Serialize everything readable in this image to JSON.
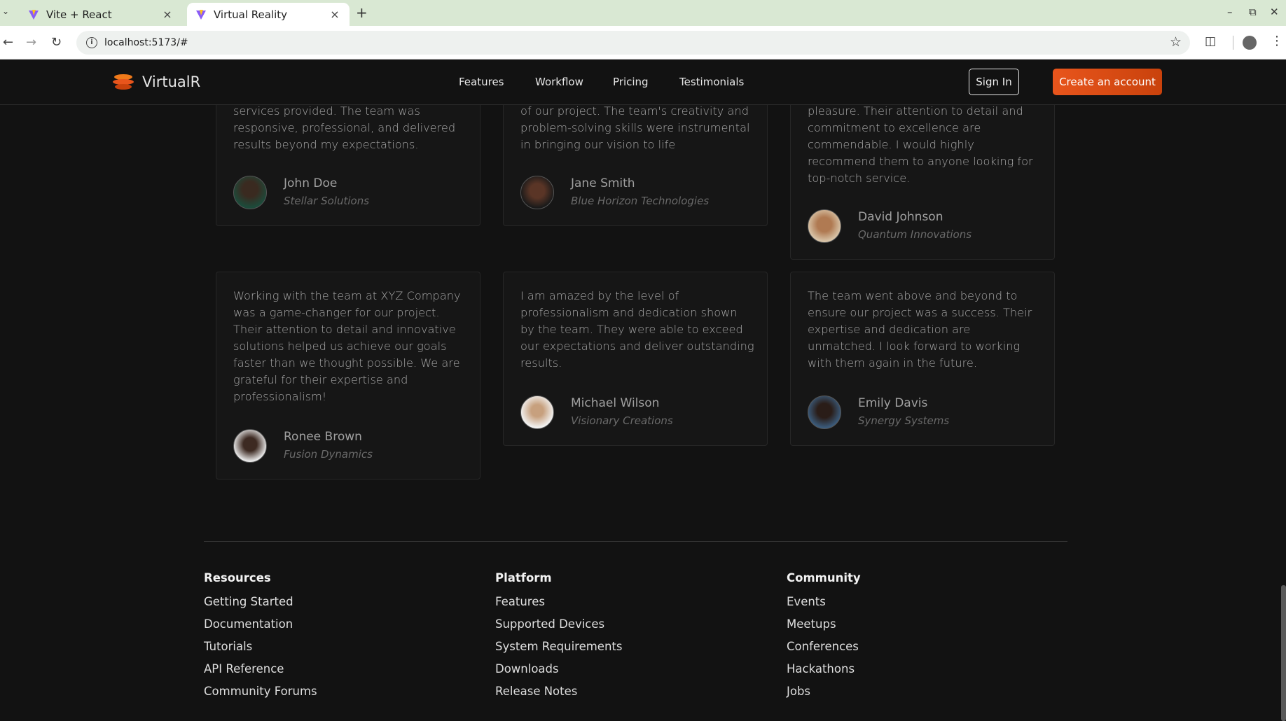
{
  "browser": {
    "tabs": [
      {
        "title": "Vite + React",
        "favicon": "vite-icon"
      },
      {
        "title": "Virtual Reality",
        "favicon": "vite-icon"
      }
    ],
    "close_glyph": "×",
    "new_tab_glyph": "+",
    "url": "localhost:5173/#"
  },
  "header": {
    "logo_text": "VirtualR",
    "nav": [
      "Features",
      "Workflow",
      "Pricing",
      "Testimonials"
    ],
    "sign_in": "Sign In",
    "create_account": "Create an account",
    "accent_color": "#e8551c"
  },
  "testimonials": [
    {
      "text": "services provided. The team was responsive, professional, and delivered results beyond my expectations.",
      "name": "John Doe",
      "company": "Stellar Solutions"
    },
    {
      "text": "of our project. The team's creativity and problem-solving skills were instrumental in bringing our vision to life",
      "name": "Jane Smith",
      "company": "Blue Horizon Technologies"
    },
    {
      "text": "pleasure. Their attention to detail and commitment to excellence are commendable. I would highly recommend them to anyone looking for top-notch service.",
      "name": "David Johnson",
      "company": "Quantum Innovations"
    },
    {
      "text": "Working with the team at XYZ Company was a game-changer for our project. Their attention to detail and innovative solutions helped us achieve our goals faster than we thought possible. We are grateful for their expertise and professionalism!",
      "name": "Ronee Brown",
      "company": "Fusion Dynamics"
    },
    {
      "text": "I am amazed by the level of professionalism and dedication shown by the team. They were able to exceed our expectations and deliver outstanding results.",
      "name": "Michael Wilson",
      "company": "Visionary Creations"
    },
    {
      "text": "The team went above and beyond to ensure our project was a success. Their expertise and dedication are unmatched. I look forward to working with them again in the future.",
      "name": "Emily Davis",
      "company": "Synergy Systems"
    }
  ],
  "footer": {
    "columns": [
      {
        "heading": "Resources",
        "links": [
          "Getting Started",
          "Documentation",
          "Tutorials",
          "API Reference",
          "Community Forums"
        ]
      },
      {
        "heading": "Platform",
        "links": [
          "Features",
          "Supported Devices",
          "System Requirements",
          "Downloads",
          "Release Notes"
        ]
      },
      {
        "heading": "Community",
        "links": [
          "Events",
          "Meetups",
          "Conferences",
          "Hackathons",
          "Jobs"
        ]
      }
    ]
  }
}
